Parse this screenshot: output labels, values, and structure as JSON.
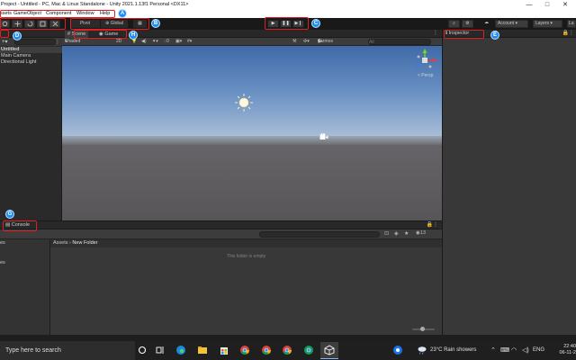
{
  "window": {
    "title": "Project - Untitled - PC, Mac & Linux Standalone - Unity 2021.1.13f1 Personal <DX11>",
    "minimize": "—",
    "maximize": "□",
    "close": "✕"
  },
  "menu": {
    "items": [
      "ssets",
      "GameObject",
      "Component",
      "Window",
      "Help"
    ]
  },
  "toolbar": {
    "pivot_label": "Pivot",
    "global_label": "Global",
    "account_label": "Account",
    "layers_label": "Layers",
    "layout_label": "La"
  },
  "markers": {
    "a": "A",
    "b": "B",
    "c": "C",
    "d": "D",
    "e": "E",
    "g": "G",
    "h": "H"
  },
  "hierarchy": {
    "search_placeholder": "",
    "items": [
      "Untitled",
      "Main Camera",
      "Directional Light"
    ]
  },
  "scene": {
    "tabs": [
      "Scene",
      "Game"
    ],
    "shading": "Shaded",
    "mode_2d": "2D",
    "gizmos_label": "Gizmos",
    "persp_label": "< Persp",
    "all_label": "All"
  },
  "inspector": {
    "tab_label": "Inspector"
  },
  "console": {
    "tab_label": "Console"
  },
  "project": {
    "breadcrumb_root": "Assets",
    "breadcrumb_sep": "›",
    "breadcrumb_folder": "New Folder",
    "empty_message": "This folder is empty",
    "left_items": [
      "es",
      "es"
    ],
    "count_label": "13"
  },
  "taskbar": {
    "search_placeholder": "Type here to search",
    "weather": "23°C  Rain showers",
    "lang": "ENG",
    "time": "22:40",
    "date": "06-11-2"
  },
  "colors": {
    "accent_red": "#e02020",
    "marker_blue": "#1e8ff0",
    "sky_top": "#3f6aa8",
    "ground": "#5e5b5e"
  }
}
